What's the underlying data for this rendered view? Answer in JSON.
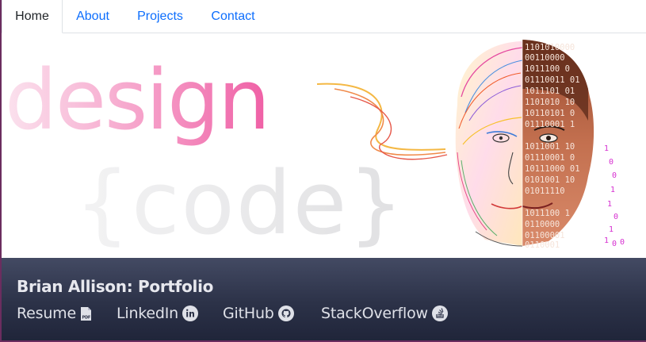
{
  "nav": {
    "tabs": [
      {
        "label": "Home",
        "active": true
      },
      {
        "label": "About",
        "active": false
      },
      {
        "label": "Projects",
        "active": false
      },
      {
        "label": "Contact",
        "active": false
      }
    ]
  },
  "hero": {
    "word_design": "design",
    "word_code": "{code}",
    "binary_rows": [
      "1101010000",
      "00110000",
      "1011100 0",
      "01110011 01",
      "1011101 01",
      "1101010 10",
      "10110101 0",
      "01110001 1",
      "1011001 10",
      "01110001 0",
      "10111000 01",
      "0101001 10",
      "01011110",
      "1011100 1",
      "0110000",
      "01100001",
      "0110001"
    ],
    "binary_stream": [
      "1",
      "0",
      "0",
      "1",
      "1",
      "0",
      "1",
      "1",
      "0",
      "0"
    ]
  },
  "footer": {
    "title": "Brian Allison: Portfolio",
    "links": [
      {
        "label": "Resume",
        "icon": "pdf-file-icon"
      },
      {
        "label": "LinkedIn",
        "icon": "linkedin-icon"
      },
      {
        "label": "GitHub",
        "icon": "github-icon"
      },
      {
        "label": "StackOverflow",
        "icon": "stackoverflow-icon"
      }
    ]
  },
  "colors": {
    "link_blue": "#0d6efd",
    "design_pink": "#f06aa8",
    "code_gray": "#e2e2e4",
    "footer_dark": "#2c3248",
    "binary_magenta": "#d62fd0"
  }
}
